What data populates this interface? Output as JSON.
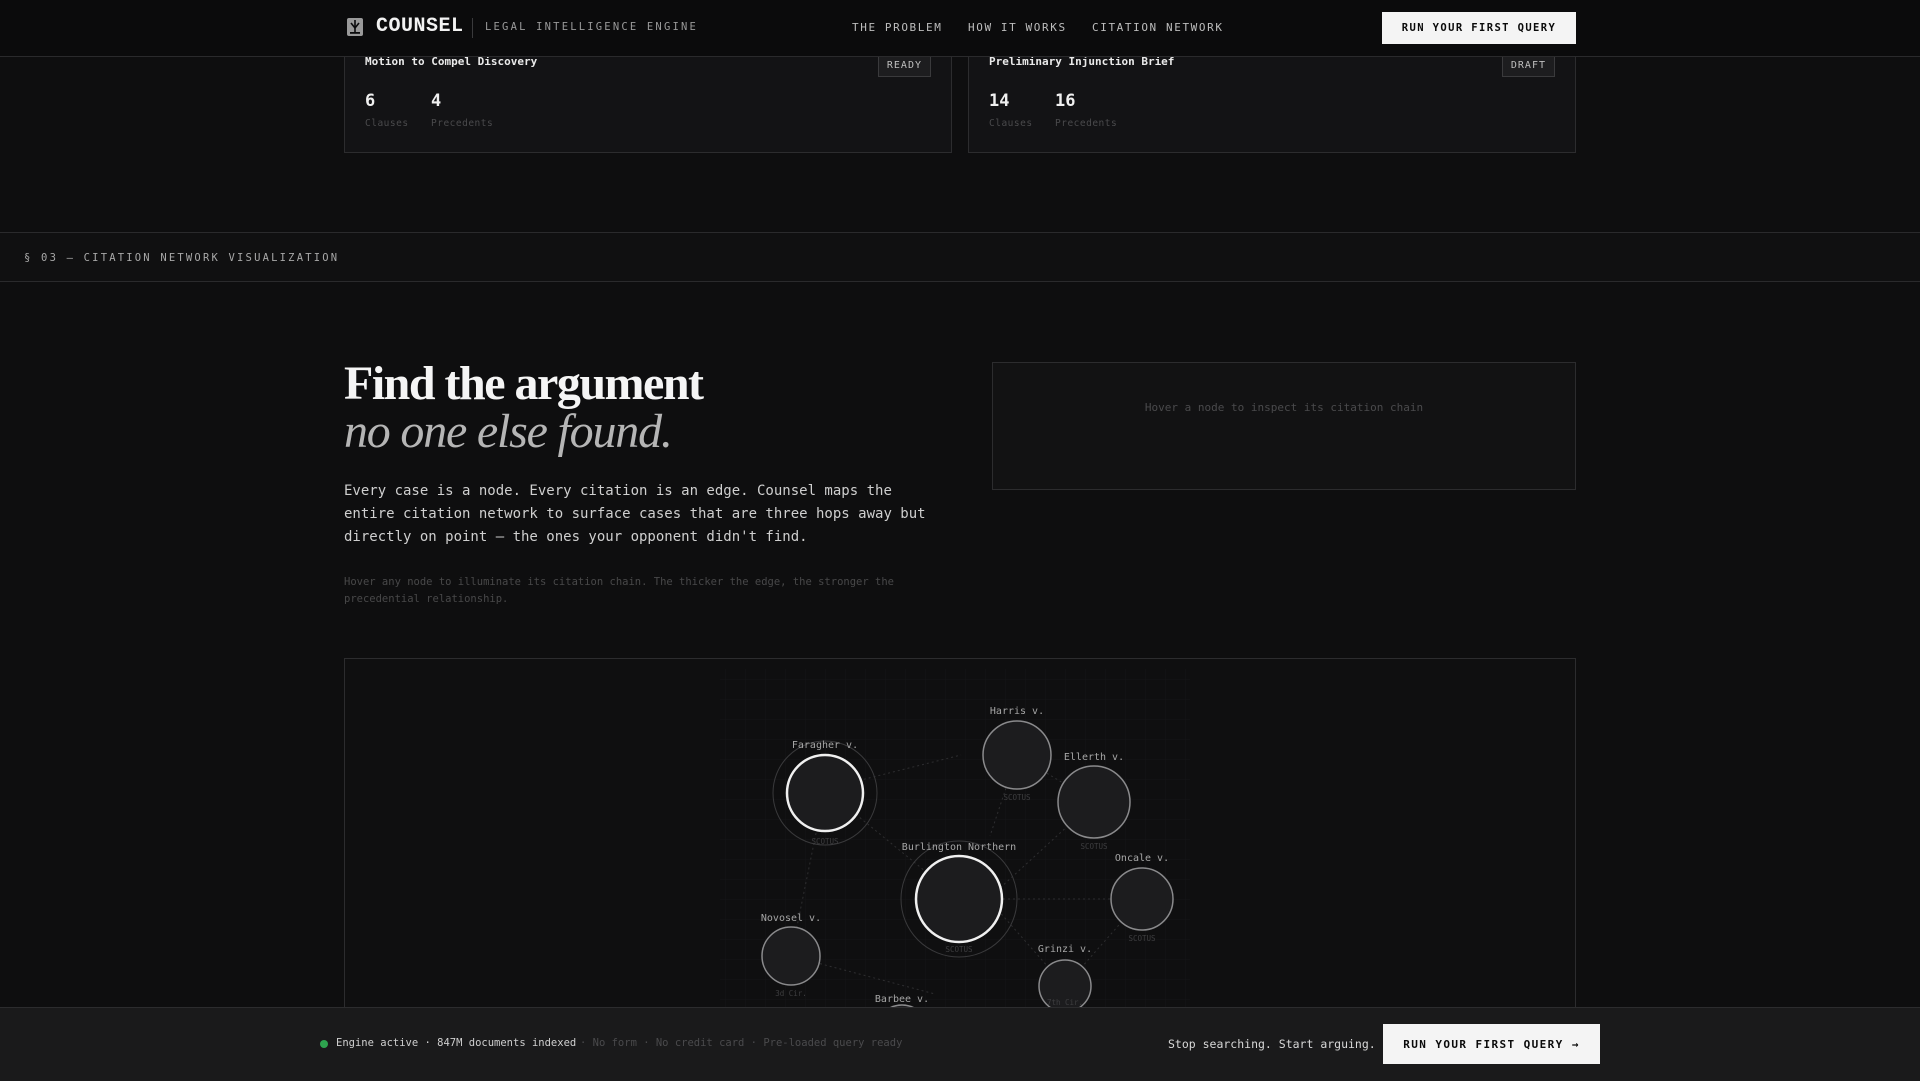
{
  "nav": {
    "logo_icon": "scales-icon",
    "brand": "COUNSEL",
    "tagline": "LEGAL INTELLIGENCE ENGINE",
    "links": [
      "THE PROBLEM",
      "HOW IT WORKS",
      "CITATION NETWORK"
    ],
    "cta": "RUN YOUR FIRST QUERY"
  },
  "cards": [
    {
      "title": "Motion to Compel Discovery",
      "badge": "READY",
      "stats": [
        {
          "value": "6",
          "label": "Clauses"
        },
        {
          "value": "4",
          "label": "Precedents"
        }
      ]
    },
    {
      "title": "Preliminary Injunction Brief",
      "badge": "DRAFT",
      "stats": [
        {
          "value": "14",
          "label": "Clauses"
        },
        {
          "value": "16",
          "label": "Precedents"
        }
      ]
    }
  ],
  "section": {
    "label": "§ 03 — CITATION NETWORK VISUALIZATION"
  },
  "hero": {
    "headline": "Find the argument",
    "headline_italic": "no one else found.",
    "body": "Every case is a node. Every citation is an edge. Counsel maps the entire citation network to surface cases that are three hops away but directly on point — the ones your opponent didn't find.",
    "hint": "Hover any node to illuminate its citation chain. The thicker the edge, the stronger the precedential relationship."
  },
  "inspector": {
    "placeholder": "Hover a node to inspect its citation chain"
  },
  "graph": {
    "nodes": [
      {
        "label": "Faragher v.",
        "sub": "SCOTUS"
      },
      {
        "label": "Harris v.",
        "sub": "SCOTUS"
      },
      {
        "label": "Ellerth v.",
        "sub": "SCOTUS"
      },
      {
        "label": "Burlington Northern",
        "sub": "SCOTUS"
      },
      {
        "label": "Oncale v.",
        "sub": "SCOTUS"
      },
      {
        "label": "Novosel v.",
        "sub": "3d Cir."
      },
      {
        "label": "Grinzi v.",
        "sub": "7th Cir."
      },
      {
        "label": "Barbee v.",
        "sub": ""
      }
    ]
  },
  "footer": {
    "status": "Engine active · 847M documents indexed",
    "sub": "· No form · No credit card · Pre-loaded query ready",
    "tagline": "Stop searching. Start arguing.",
    "cta": "RUN YOUR FIRST QUERY →"
  },
  "colors": {
    "accent": "#f4f4f4",
    "background": "#0e0e0f",
    "status_green": "#2ea44f"
  }
}
